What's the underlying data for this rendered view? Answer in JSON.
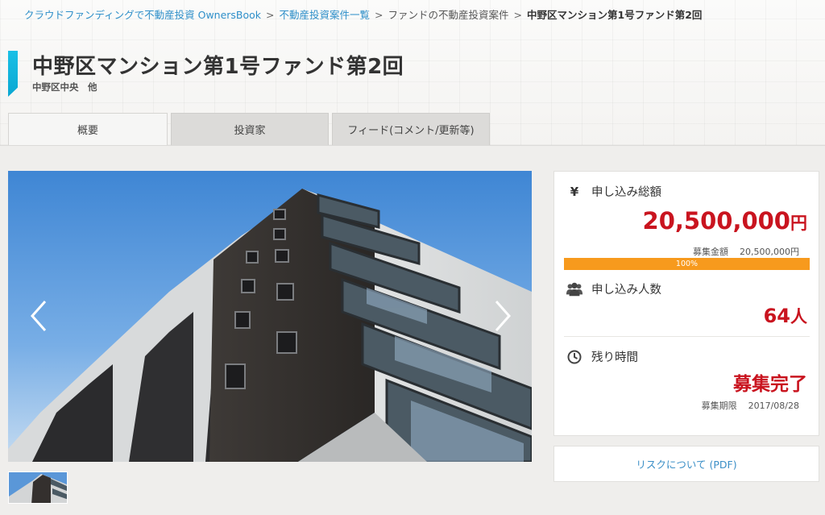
{
  "breadcrumb": {
    "items": [
      "クラウドファンディングで不動産投資 OwnersBook",
      "不動産投資案件一覧",
      "ファンドの不動産投資案件"
    ],
    "separator": ">",
    "current": "中野区マンション第1号ファンド第2回"
  },
  "header": {
    "title": "中野区マンション第1号ファンド第2回",
    "subtitle": "中野区中央　他"
  },
  "tabs": [
    {
      "label": "概要",
      "active": true
    },
    {
      "label": "投資家",
      "active": false
    },
    {
      "label": "フィード(コメント/更新等)",
      "active": false
    }
  ],
  "carousel": {
    "prev_icon": "chevron-left-icon",
    "next_icon": "chevron-right-icon"
  },
  "stats": {
    "total": {
      "icon": "yen-icon",
      "icon_glyph": "¥",
      "label": "申し込み総額",
      "amount": "20,500,000",
      "unit": "円",
      "target_label": "募集金額",
      "target_value": "20,500,000円",
      "progress_percent": 100,
      "progress_label": "100%"
    },
    "applicants": {
      "icon": "users-icon",
      "label": "申し込み人数",
      "count": "64",
      "unit": "人"
    },
    "remaining": {
      "icon": "clock-icon",
      "label": "残り時間",
      "status": "募集完了",
      "deadline_label": "募集期限",
      "deadline_value": "2017/08/28"
    }
  },
  "risk": {
    "link_label": "リスクについて (PDF)"
  },
  "colors": {
    "accent": "#19c0e6",
    "link": "#2e8fc9",
    "highlight_red": "#c9141f",
    "progress_orange": "#f79a1d"
  }
}
